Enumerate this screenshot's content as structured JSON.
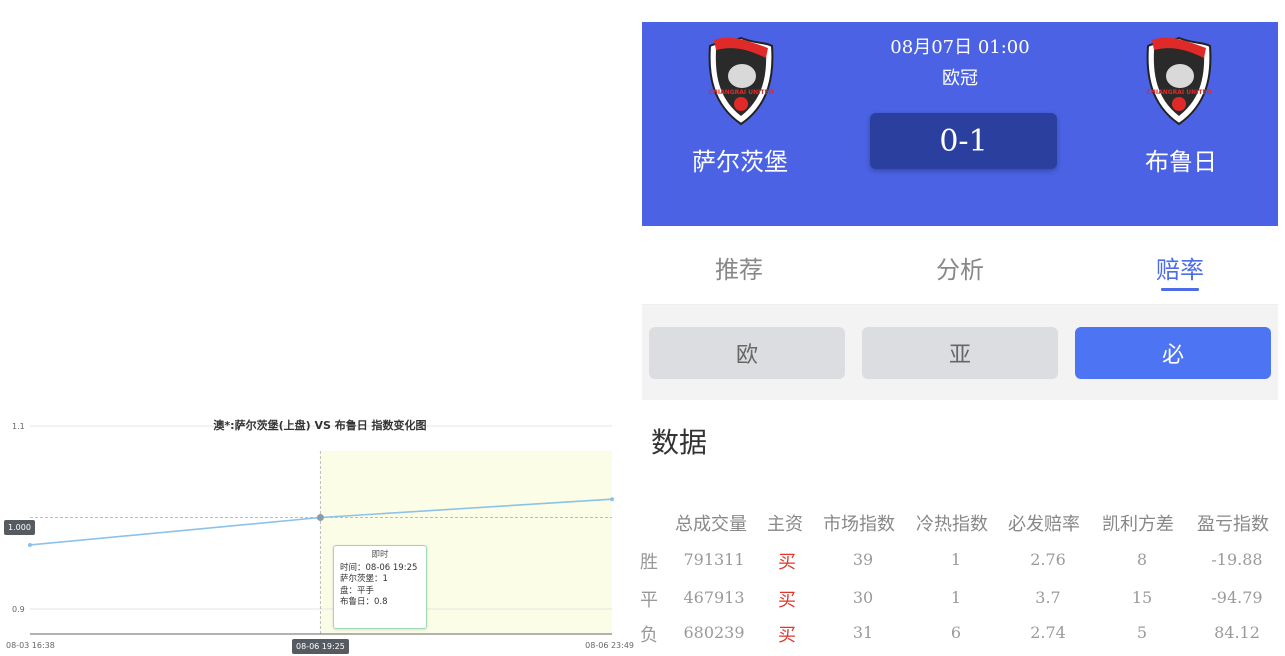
{
  "chart_data": {
    "type": "line",
    "title": "澳*:萨尔茨堡(上盘) VS 布鲁日 指数变化图",
    "x": [
      "08-03 16:38",
      "08-06 19:25",
      "08-06 23:49"
    ],
    "series": [
      {
        "values": [
          0.97,
          1.0,
          1.02
        ]
      }
    ],
    "ylim": [
      0.9,
      1.1
    ],
    "yticks": [
      "1.1",
      "0.9"
    ],
    "xticks": [
      "08-03 16:38",
      "08-06 23:49"
    ],
    "crosshair": {
      "x_label": "08-06 19:25",
      "y_label": "1.000"
    },
    "tooltip": {
      "head": "即时",
      "lines": [
        "时间：08-06 19:25",
        "萨尔茨堡：1",
        "盘：平手",
        "布鲁日：0.8"
      ]
    },
    "colors": {
      "line": "#8cc2ea",
      "highlight": "#fcfde6",
      "crosshair": "#bbbbbb"
    }
  },
  "match": {
    "time": "08月07日 01:00",
    "league": "欧冠",
    "score": "0-1",
    "home": {
      "name": "萨尔茨堡",
      "logo": "chiangrai-united-crest",
      "logo_text": "CHIANGRAI UNITED"
    },
    "away": {
      "name": "布鲁日",
      "logo": "chiangrai-united-crest",
      "logo_text": "CHIANGRAI UNITED"
    },
    "colors": {
      "header_bg": "#4a62e3",
      "score_bg": "#2b3f9e"
    }
  },
  "tabs": [
    {
      "label": "推荐",
      "active": false
    },
    {
      "label": "分析",
      "active": false
    },
    {
      "label": "赔率",
      "active": true
    }
  ],
  "sub_tabs": [
    {
      "label": "欧",
      "active": false
    },
    {
      "label": "亚",
      "active": false
    },
    {
      "label": "必",
      "active": true
    }
  ],
  "section_title": "数据",
  "table": {
    "headers": [
      "总成交量",
      "主资",
      "市场指数",
      "冷热指数",
      "必发赔率",
      "凯利方差",
      "盈亏指数"
    ],
    "rows": [
      {
        "label": "胜",
        "cells": [
          "791311",
          "买",
          "39",
          "1",
          "2.76",
          "8",
          "-19.88"
        ]
      },
      {
        "label": "平",
        "cells": [
          "467913",
          "买",
          "30",
          "1",
          "3.7",
          "15",
          "-94.79"
        ]
      },
      {
        "label": "负",
        "cells": [
          "680239",
          "买",
          "31",
          "6",
          "2.74",
          "5",
          "84.12"
        ]
      }
    ]
  },
  "colors": {
    "accent": "#4d6ce8",
    "buy": "#e0362c"
  }
}
